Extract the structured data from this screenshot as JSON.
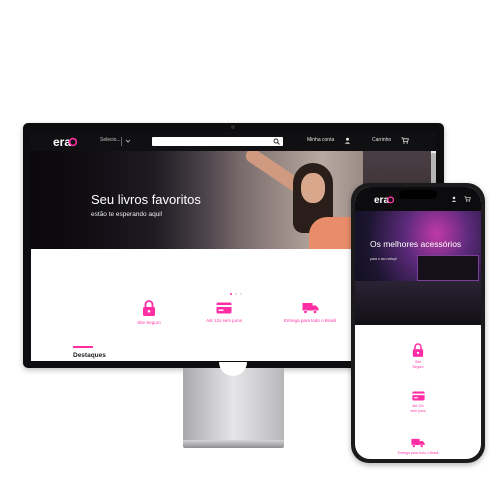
{
  "colors": {
    "accent": "#ff2ea5",
    "nav_bg": "#101012",
    "page_bg": "#ffffff"
  },
  "desktop": {
    "logo_text": "era",
    "nav": {
      "select_label": "Selecio...",
      "search": {
        "placeholder": "",
        "icon": "search-icon"
      },
      "account_label": "Minha conta",
      "cart_label": "Carrinho"
    },
    "hero": {
      "title": "Seu livros favoritos",
      "subtitle": "estão te esperando aqui!",
      "slide_count": 3,
      "active_slide": 1
    },
    "features": [
      {
        "icon": "lock-icon",
        "label": "Site Seguro"
      },
      {
        "icon": "credit-card-icon",
        "label": "Até 12x sem juros"
      },
      {
        "icon": "truck-icon",
        "label": "Entrega para todo o Brasil"
      }
    ],
    "section_title": "Destaques"
  },
  "mobile": {
    "logo_text": "era",
    "hero": {
      "title": "Os melhores acessórios",
      "subtitle": "para o seu setup!",
      "slide_count": 3,
      "active_slide": 2
    },
    "features": [
      {
        "icon": "lock-icon",
        "label_line1": "Site",
        "label_line2": "Seguro"
      },
      {
        "icon": "credit-card-icon",
        "label_line1": "Até 12x",
        "label_line2": "sem juros"
      },
      {
        "icon": "truck-icon",
        "label_line1": "Entrega para todo o Brasil",
        "label_line2": ""
      }
    ]
  }
}
